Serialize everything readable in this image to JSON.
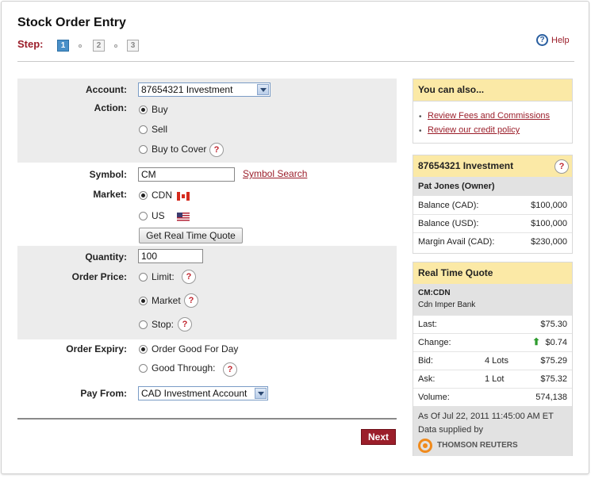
{
  "page": {
    "title": "Stock Order Entry",
    "step_label": "Step:",
    "steps": [
      "1",
      "2",
      "3"
    ],
    "help": "Help"
  },
  "form": {
    "account": {
      "label": "Account:",
      "value": "87654321 Investment"
    },
    "action": {
      "label": "Action:",
      "options": [
        "Buy",
        "Sell",
        "Buy to Cover"
      ],
      "selected": "Buy"
    },
    "symbol": {
      "label": "Symbol:",
      "value": "CM",
      "search_link": "Symbol Search"
    },
    "market": {
      "label": "Market:",
      "options": [
        "CDN",
        "US"
      ],
      "selected": "CDN"
    },
    "quote_button": "Get Real Time Quote",
    "quantity": {
      "label": "Quantity:",
      "value": "100"
    },
    "order_price": {
      "label": "Order Price:",
      "options": [
        "Limit:",
        "Market",
        "Stop:"
      ],
      "selected": "Market"
    },
    "order_expiry": {
      "label": "Order Expiry:",
      "options": [
        "Order Good For Day",
        "Good Through:"
      ],
      "selected": "Order Good For Day"
    },
    "pay_from": {
      "label": "Pay From:",
      "value": "CAD Investment Account"
    },
    "next_button": "Next"
  },
  "sidebar": {
    "also": {
      "title": "You can also...",
      "links": [
        "Review Fees and Commissions",
        "Review our credit policy"
      ]
    },
    "account": {
      "title": "87654321 Investment",
      "owner": "Pat Jones (Owner)",
      "rows": [
        {
          "label": "Balance (CAD):",
          "value": "$100,000"
        },
        {
          "label": "Balance (USD):",
          "value": "$100,000"
        },
        {
          "label": "Margin Avail (CAD):",
          "value": "$230,000"
        }
      ]
    },
    "quote": {
      "title": "Real Time Quote",
      "symbol": "CM:CDN",
      "name": "Cdn Imper Bank",
      "last": {
        "label": "Last:",
        "value": "$75.30"
      },
      "change": {
        "label": "Change:",
        "value": "$0.74"
      },
      "bid": {
        "label": "Bid:",
        "lots": "4 Lots",
        "value": "$75.29"
      },
      "ask": {
        "label": "Ask:",
        "lots": "1 Lot",
        "value": "$75.32"
      },
      "volume": {
        "label": "Volume:",
        "value": "574,138"
      },
      "as_of": "As Of Jul 22, 2011 11:45:00 AM ET",
      "supplied": "Data supplied by",
      "provider": "THOMSON REUTERS"
    }
  },
  "colors": {
    "accent": "#9b1e2a",
    "band": "#ececec",
    "sidebar_header": "#fbe9a6",
    "change_up": "#2e9b2e"
  }
}
